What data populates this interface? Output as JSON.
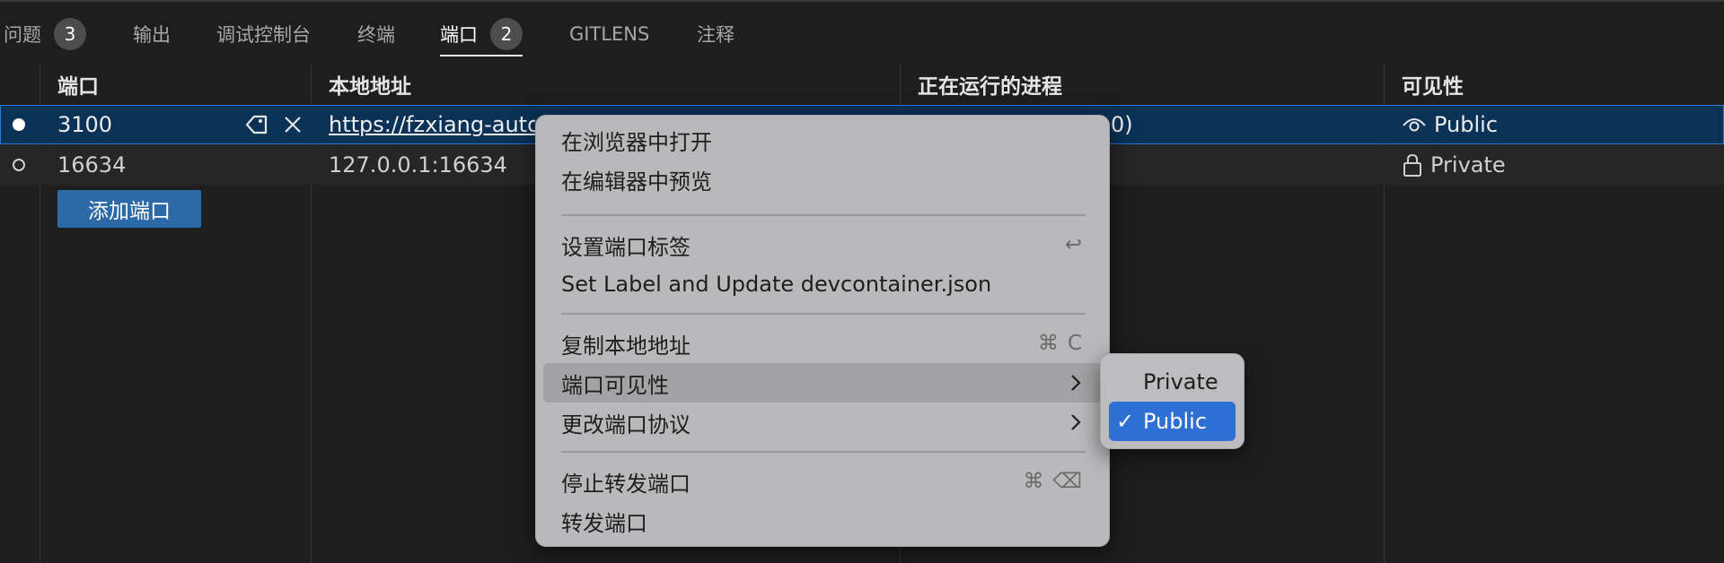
{
  "tabs": [
    {
      "label": "问题",
      "badge": "3"
    },
    {
      "label": "输出"
    },
    {
      "label": "调试控制台"
    },
    {
      "label": "终端"
    },
    {
      "label": "端口",
      "badge": "2"
    },
    {
      "label": "GITLENS"
    },
    {
      "label": "注释"
    }
  ],
  "columns": {
    "port": "端口",
    "local_address": "本地地址",
    "process": "正在运行的进程",
    "visibility": "可见性"
  },
  "rows": [
    {
      "port": "3100",
      "local_address": "https://fzxiang-auto",
      "process_head": "",
      "process_tail": "0)",
      "visibility": "Public"
    },
    {
      "port": "16634",
      "local_address": "127.0.0.1:16634",
      "visibility": "Private"
    }
  ],
  "add_port_label": "添加端口",
  "context_menu": {
    "items": [
      {
        "label": "在浏览器中打开"
      },
      {
        "label": "在编辑器中预览"
      },
      {
        "label": "设置端口标签",
        "shortcut": "↩"
      },
      {
        "label": "Set Label and Update devcontainer.json"
      },
      {
        "label": "复制本地地址",
        "shortcut_mod": "⌘",
        "shortcut_key": "C"
      },
      {
        "label": "端口可见性",
        "submenu": true
      },
      {
        "label": "更改端口协议",
        "submenu": true
      },
      {
        "label": "停止转发端口",
        "shortcut_mod": "⌘",
        "shortcut_key": "⌫"
      },
      {
        "label": "转发端口"
      }
    ]
  },
  "visibility_submenu": {
    "options": [
      "Private",
      "Public"
    ],
    "selected": "Public",
    "check_mark": "✓"
  },
  "colors": {
    "background": "#1e1e1e",
    "selected_row": "#0a3156",
    "focus_border": "#2b79d6",
    "button": "#2b6aa6",
    "menu_bg": "#b9b9bb",
    "submenu_selected": "#2f6ed3"
  }
}
